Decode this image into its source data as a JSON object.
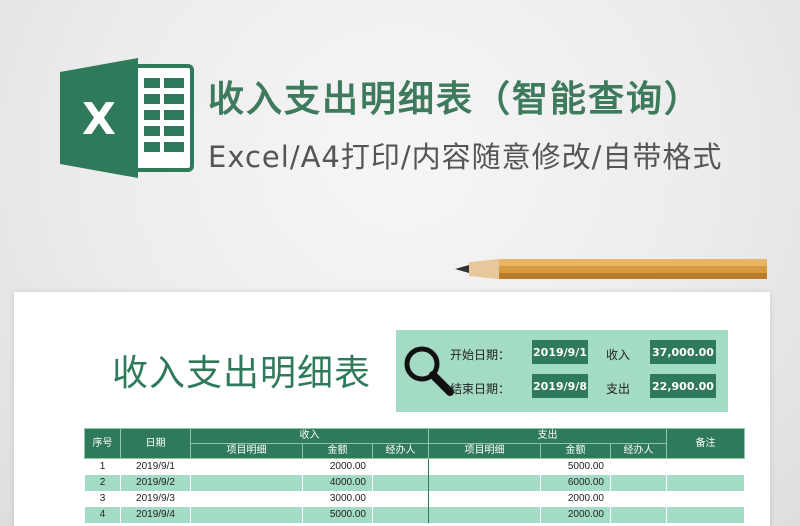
{
  "banner": {
    "logo_letter": "X",
    "title": "收入支出明细表（智能查询）",
    "subtitle": "Excel/A4打印/内容随意修改/自带格式"
  },
  "sheet": {
    "title": "收入支出明细表",
    "query": {
      "start_label": "开始日期：",
      "start_value": "2019/9/1",
      "end_label": "结束日期：",
      "end_value": "2019/9/8",
      "income_label": "收入",
      "income_value": "37,000.00",
      "expense_label": "支出",
      "expense_value": "22,900.00"
    },
    "table": {
      "headers": {
        "no": "序号",
        "date": "日期",
        "income": "收入",
        "expense": "支出",
        "remark": "备注",
        "item": "项目明细",
        "amount": "金额",
        "handler": "经办人"
      },
      "rows": [
        {
          "no": "1",
          "date": "2019/9/1",
          "inc_item": "",
          "inc_amount": "2000.00",
          "inc_handler": "",
          "exp_item": "",
          "exp_amount": "5000.00",
          "exp_handler": "",
          "remark": ""
        },
        {
          "no": "2",
          "date": "2019/9/2",
          "inc_item": "",
          "inc_amount": "4000.00",
          "inc_handler": "",
          "exp_item": "",
          "exp_amount": "6000.00",
          "exp_handler": "",
          "remark": ""
        },
        {
          "no": "3",
          "date": "2019/9/3",
          "inc_item": "",
          "inc_amount": "3000.00",
          "inc_handler": "",
          "exp_item": "",
          "exp_amount": "2000.00",
          "exp_handler": "",
          "remark": ""
        },
        {
          "no": "4",
          "date": "2019/9/4",
          "inc_item": "",
          "inc_amount": "5000.00",
          "inc_handler": "",
          "exp_item": "",
          "exp_amount": "2000.00",
          "exp_handler": "",
          "remark": ""
        }
      ]
    }
  },
  "colors": {
    "brand_green": "#2f7a5a",
    "light_green": "#a4dbc4",
    "title_green": "#3e7a5c"
  },
  "icons": [
    "excel-logo-icon",
    "magnifier-icon",
    "pencil-icon"
  ]
}
